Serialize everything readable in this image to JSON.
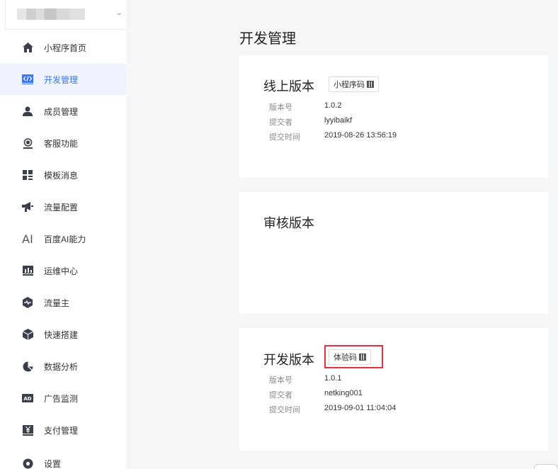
{
  "sidebar": {
    "items": [
      {
        "label": "小程序首页",
        "icon": "home-icon",
        "active": false
      },
      {
        "label": "开发管理",
        "icon": "code-icon",
        "active": true
      },
      {
        "label": "成员管理",
        "icon": "user-icon",
        "active": false
      },
      {
        "label": "客服功能",
        "icon": "headset-icon",
        "active": false
      },
      {
        "label": "模板消息",
        "icon": "template-icon",
        "active": false
      },
      {
        "label": "流量配置",
        "icon": "megaphone-icon",
        "active": false
      },
      {
        "label": "百度AI能力",
        "icon": "ai-icon",
        "active": false
      },
      {
        "label": "运维中心",
        "icon": "chart-icon",
        "active": false
      },
      {
        "label": "流量主",
        "icon": "pulse-icon",
        "active": false
      },
      {
        "label": "快速搭建",
        "icon": "cube-icon",
        "active": false
      },
      {
        "label": "数据分析",
        "icon": "pie-icon",
        "active": false
      },
      {
        "label": "广告监测",
        "icon": "ad-icon",
        "active": false
      },
      {
        "label": "支付管理",
        "icon": "yuan-icon",
        "active": false
      },
      {
        "label": "设置",
        "icon": "gear-icon",
        "active": false
      }
    ]
  },
  "main": {
    "title": "开发管理",
    "online": {
      "title": "线上版本",
      "qr_label": "小程序码",
      "version_label": "版本号",
      "version": "1.0.2",
      "submitter_label": "提交者",
      "submitter": "lyyibaikf",
      "time_label": "提交时间",
      "time": "2019-08-26 13:56:19"
    },
    "review": {
      "title": "审核版本"
    },
    "dev": {
      "title": "开发版本",
      "qr_label": "体验码",
      "version_label": "版本号",
      "version": "1.0.1",
      "submitter_label": "提交者",
      "submitter": "netking001",
      "time_label": "提交时间",
      "time": "2019-09-01 11:04:04"
    }
  },
  "colors": {
    "accent": "#3c76f8",
    "highlight": "#e5323b",
    "background": "#f5f6f8"
  }
}
